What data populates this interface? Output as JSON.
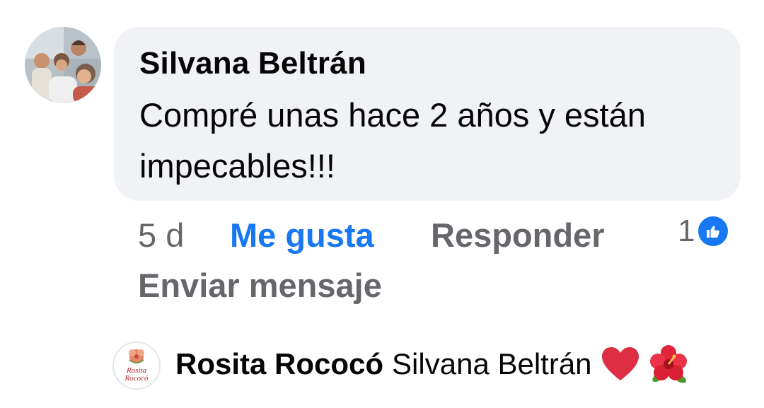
{
  "comment": {
    "author": "Silvana Beltrán",
    "text": "Compré unas hace 2 años y están impecables!!!",
    "time": "5 d",
    "actions": {
      "like": "Me gusta",
      "reply": "Responder",
      "send_message": "Enviar mensaje"
    },
    "reaction": {
      "count": "1",
      "icon": "thumbs-up-icon"
    },
    "avatar": "group-photo-avatar"
  },
  "reply": {
    "author": "Rosita Rococó",
    "text": "Silvana Beltrán",
    "emojis": [
      "heart-icon",
      "hibiscus-icon"
    ],
    "avatar_logo_text": "Rosita Rococó"
  },
  "colors": {
    "bubble": "#f0f2f5",
    "link": "#1877f2",
    "secondary": "#65676b",
    "primary": "#050505"
  }
}
